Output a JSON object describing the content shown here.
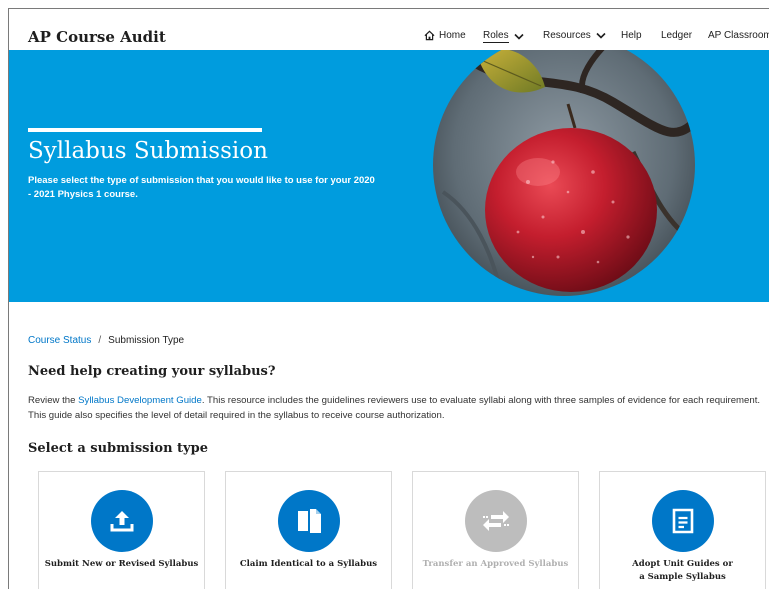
{
  "header": {
    "brand": "AP Course Audit",
    "nav": [
      {
        "label": "Home"
      },
      {
        "label": "Roles"
      },
      {
        "label": "Resources"
      },
      {
        "label": "Help"
      },
      {
        "label": "Ledger"
      },
      {
        "label": "AP Classroom"
      }
    ]
  },
  "hero": {
    "title": "Syllabus Submission",
    "subtitle": "Please select the type of submission that you would like to use for your 2020 - 2021 Physics 1 course.",
    "bg_color": "#009cde"
  },
  "breadcrumb": {
    "link": "Course Status",
    "separator": "/",
    "current": "Submission Type"
  },
  "help": {
    "heading": "Need help creating your syllabus?",
    "text_before": "Review the ",
    "link": "Syllabus Development Guide",
    "text_after": ". This resource includes the guidelines reviewers use to evaluate syllabi along with three samples of evidence for each requirement. This guide also specifies the level of detail required in the syllabus to receive course authorization."
  },
  "select": {
    "heading": "Select a submission type",
    "options": [
      {
        "label": "Submit New or Revised Syllabus",
        "icon": "upload-icon",
        "enabled": true
      },
      {
        "label": "Claim Identical to a Syllabus",
        "icon": "copy-documents-icon",
        "enabled": true
      },
      {
        "label": "Transfer an Approved Syllabus",
        "icon": "transfer-arrows-icon",
        "enabled": false
      },
      {
        "label": "Adopt Unit Guides or a Sample Syllabus",
        "line1": "Adopt Unit Guides or",
        "line2": "a Sample Syllabus",
        "icon": "document-icon",
        "enabled": true
      }
    ]
  },
  "colors": {
    "accent": "#0077c8",
    "hero": "#009cde",
    "disabled": "#bdbdbd"
  }
}
